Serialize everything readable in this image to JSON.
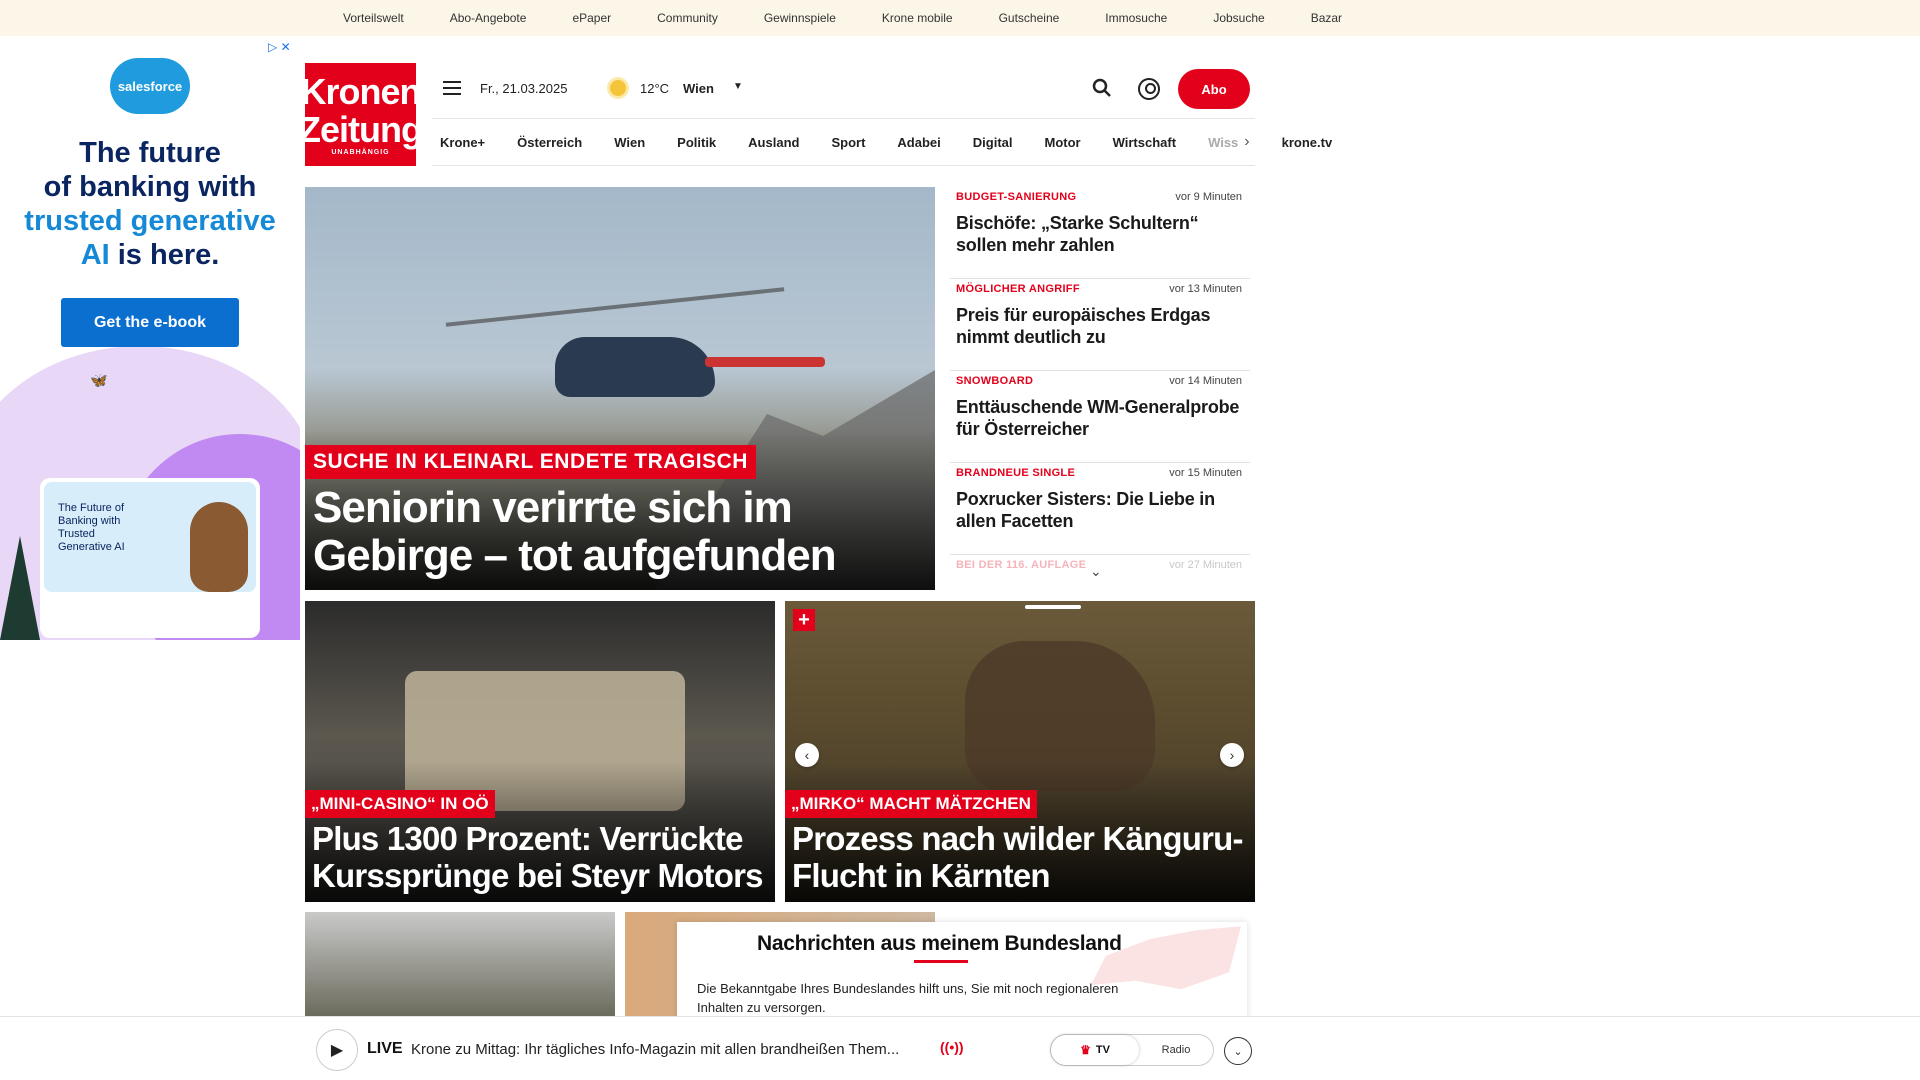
{
  "topbar": {
    "links": [
      "Vorteilswelt",
      "Abo-Angebote",
      "ePaper",
      "Community",
      "Gewinnspiele",
      "Krone mobile",
      "Gutscheine",
      "Immosuche",
      "Jobsuche",
      "Bazar"
    ]
  },
  "ad": {
    "brand": "salesforce",
    "headline_1": "The future",
    "headline_2": "of banking with",
    "headline_3": "trusted generative",
    "headline_4": "AI",
    "headline_5": "is here.",
    "cta": "Get the e-book",
    "card_text": "The Future of Banking with Trusted Generative AI",
    "adchoices": "▷ ✕"
  },
  "header": {
    "logo_line1": "Kronen",
    "logo_line2": "Zeitung",
    "logo_line3": "UNABHÄNGIG",
    "date": "Fr., 21.03.2025",
    "temperature": "12°C",
    "city": "Wien",
    "abo": "Abo"
  },
  "nav": {
    "items": [
      "Krone+",
      "Österreich",
      "Wien",
      "Politik",
      "Ausland",
      "Sport",
      "Adabei",
      "Digital",
      "Motor",
      "Wirtschaft"
    ],
    "truncated": "Wiss",
    "tv": "krone.tv"
  },
  "hero": {
    "kicker": "Suche in Kleinarl endete tragisch",
    "title": "Seniorin verirrte sich im Gebirge – tot aufgefunden"
  },
  "latest": [
    {
      "category": "Budget-Sanierung",
      "time": "vor 9 Minuten",
      "headline": "Bischöfe: „Starke Schultern“ sollen mehr zahlen"
    },
    {
      "category": "Möglicher Angriff",
      "time": "vor 13 Minuten",
      "headline": "Preis für europäisches Erdgas nimmt deutlich zu"
    },
    {
      "category": "Snowboard",
      "time": "vor 14 Minuten",
      "headline": "Enttäuschende WM-Generalprobe für Österreicher"
    },
    {
      "category": "Brandneue Single",
      "time": "vor 15 Minuten",
      "headline": "Poxrucker Sisters: Die Liebe in allen Facetten"
    },
    {
      "category": "Bei der 116. Auflage",
      "time": "vor 27 Minuten",
      "headline": ""
    }
  ],
  "cards": [
    {
      "kicker": "„Mini-Casino“ in OÖ",
      "title": "Plus 1300 Prozent: Verrückte Kurssprünge bei Steyr Motors"
    },
    {
      "kicker": "„Mirko“ macht Mätzchen",
      "title": "Prozess nach wilder Känguru-Flucht in Kärnten"
    }
  ],
  "overlay": {
    "title": "Nachrichten aus meinem Bundesland",
    "text": "Die Bekanntgabe Ihres Bundeslandes hilft uns, Sie mit noch regionaleren Inhalten zu versorgen."
  },
  "player": {
    "live": "LIVE",
    "title": "Krone zu Mittag: Ihr tägliches Info-Magazin mit allen brandheißen Them...",
    "tv": "TV",
    "radio": "Radio"
  },
  "colors": {
    "brand_red": "#e3001b",
    "topbar_bg": "#fbf6e8"
  }
}
